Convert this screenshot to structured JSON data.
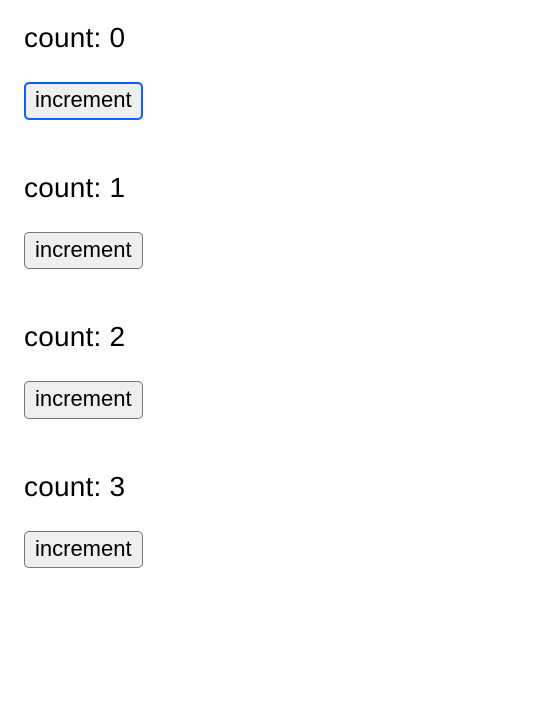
{
  "label_prefix": "count: ",
  "button_label": "increment",
  "counters": [
    {
      "value": 0,
      "focused": true
    },
    {
      "value": 1,
      "focused": false
    },
    {
      "value": 2,
      "focused": false
    },
    {
      "value": 3,
      "focused": false
    }
  ]
}
